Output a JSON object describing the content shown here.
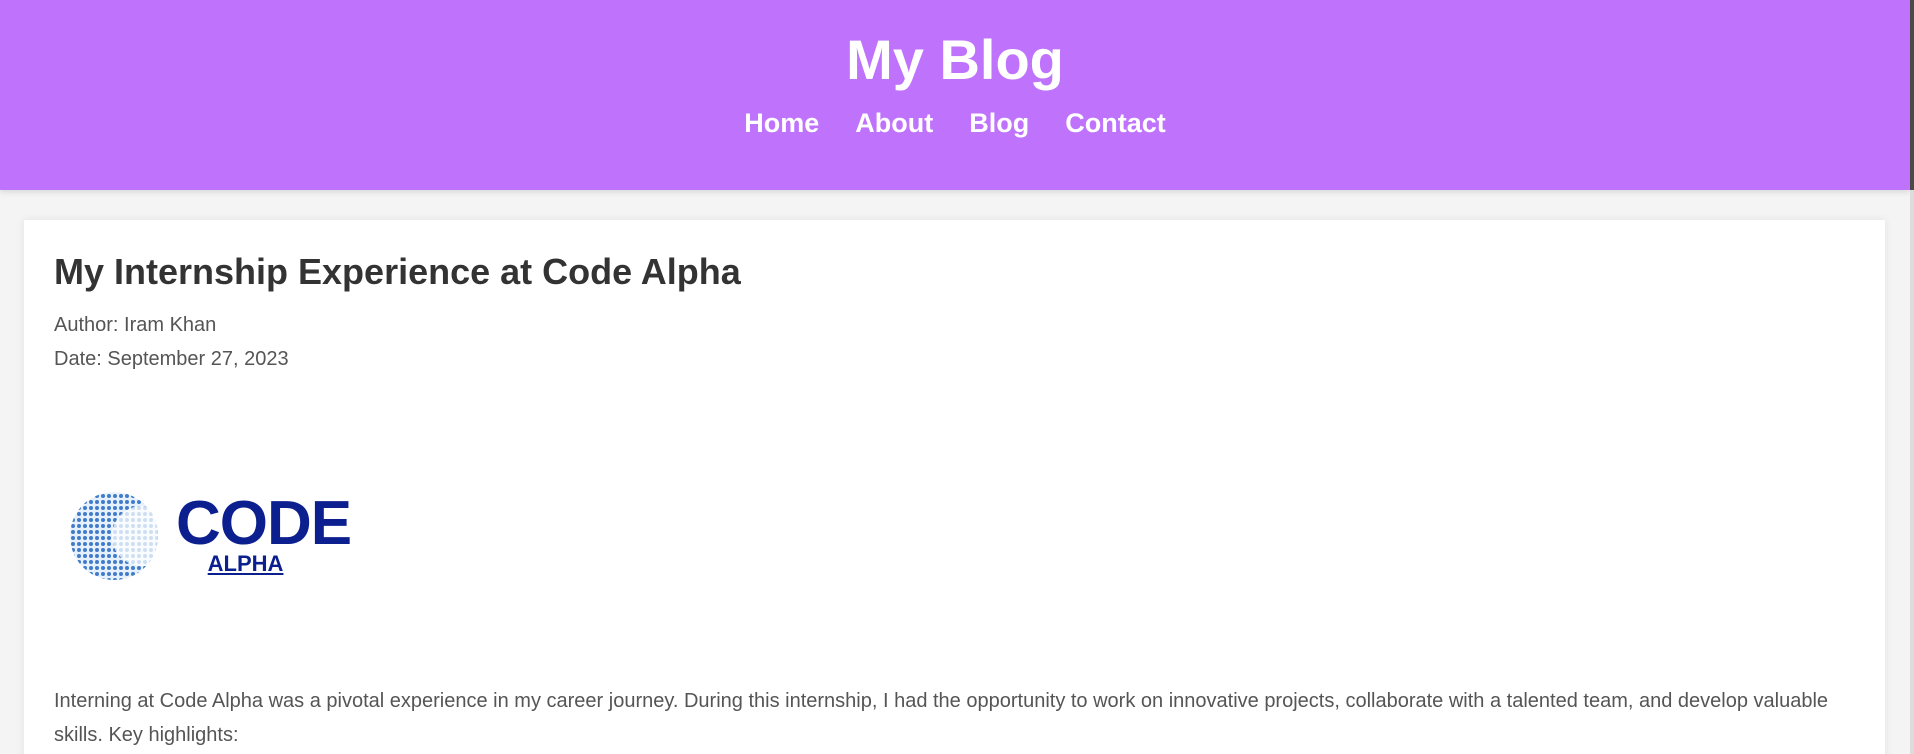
{
  "header": {
    "title": "My Blog",
    "nav": [
      {
        "label": "Home"
      },
      {
        "label": "About"
      },
      {
        "label": "Blog"
      },
      {
        "label": "Contact"
      }
    ]
  },
  "post": {
    "title": "My Internship Experience at Code Alpha",
    "author": "Author: Iram Khan",
    "date": "Date: September 27, 2023",
    "logo": {
      "word": "CODE",
      "sub": "ALPHA"
    },
    "intro": "Interning at Code Alpha was a pivotal experience in my career journey. During this internship, I had the opportunity to work on innovative projects, collaborate with a talented team, and develop valuable skills. Key highlights:"
  },
  "colors": {
    "header_bg": "#bf73fd",
    "logo_blue": "#0b1f8f",
    "text": "#555555"
  }
}
